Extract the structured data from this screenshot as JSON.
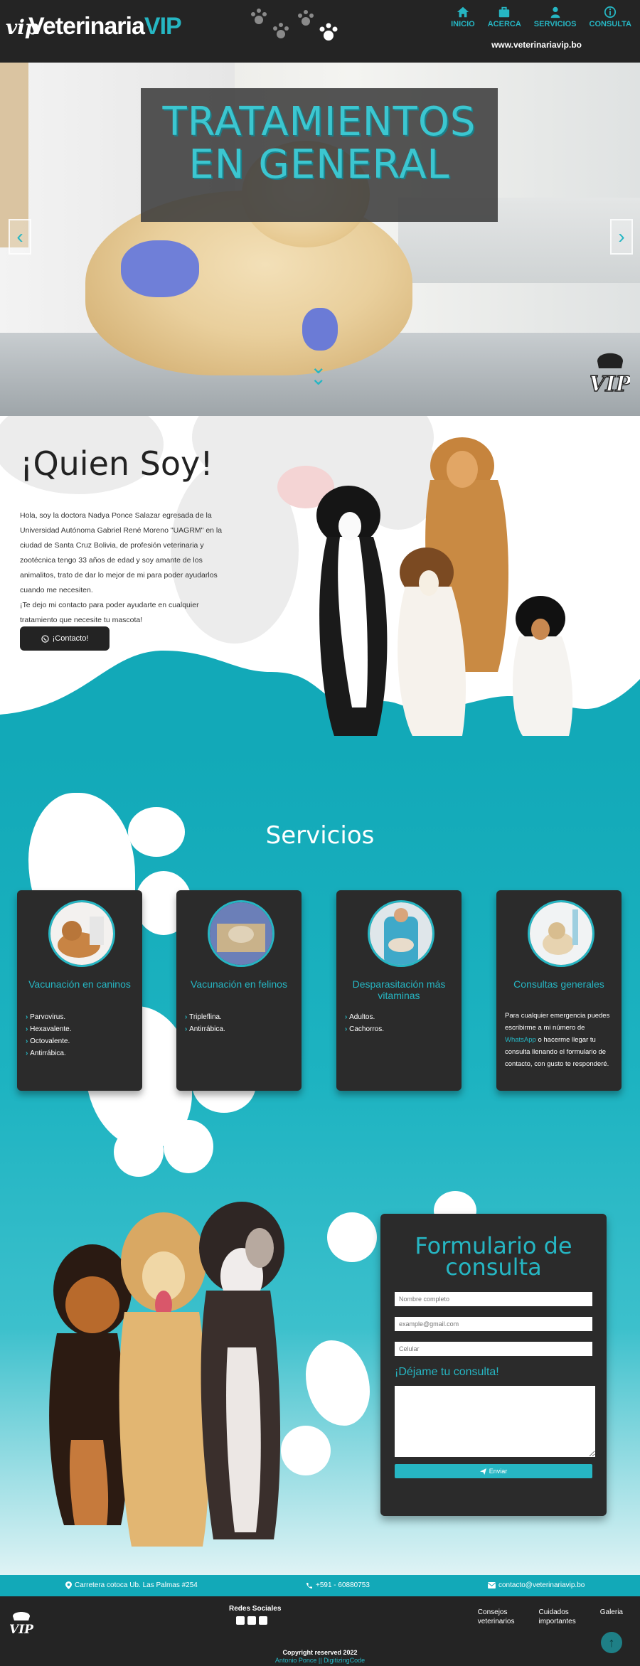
{
  "header": {
    "logo_prefix": "vip",
    "logo_name": "Veterinaria",
    "logo_accent": "VIP",
    "nav": [
      {
        "label": "INICIO",
        "icon": "home-icon"
      },
      {
        "label": "ACERCA",
        "icon": "briefcase-icon"
      },
      {
        "label": "SERVICIOS",
        "icon": "users-icon"
      },
      {
        "label": "CONSULTA",
        "icon": "info-icon"
      }
    ],
    "site_url": "www.veterinariavip.bo"
  },
  "hero": {
    "title": "TRATAMIENTOS EN GENERAL",
    "prev": "‹",
    "next": "›"
  },
  "about": {
    "title": "¡Quien Soy!",
    "paragraph1": "Hola, soy la doctora Nadya Ponce Salazar egresada de la Universidad Autónoma Gabriel René Moreno \"UAGRM\" en la ciudad de Santa Cruz Bolivia, de profesión veterinaria y zootécnica tengo 33 años de edad y soy amante de los animalitos, trato de dar lo mejor de mi para poder ayudarlos cuando me necesiten.",
    "paragraph2": "¡Te dejo mi contacto para poder ayudarte en cualquier tratamiento que necesite tu mascota!",
    "button": "¡Contacto!"
  },
  "services": {
    "title": "Servicios",
    "cards": [
      {
        "title": "Vacunación en caninos",
        "items": [
          "Parvovirus.",
          "Hexavalente.",
          "Octovalente.",
          "Antirrábica."
        ]
      },
      {
        "title": "Vacunación en felinos",
        "items": [
          "Tripleflina.",
          "Antirrábica."
        ]
      },
      {
        "title": "Desparasitación más vitaminas",
        "items": [
          "Adultos.",
          "Cachorros."
        ]
      },
      {
        "title": "Consultas generales",
        "text_before": "Para cualquier emergencia puedes escribirme a mi número de",
        "text_link": "WhatsApp",
        "text_after": "o hacerme llegar tu consulta llenando el formulario de contacto, con gusto te responderé."
      }
    ]
  },
  "form": {
    "title": "Formulario de consulta",
    "name_placeholder": "Nombre completo",
    "email_placeholder": "example@gmail.com",
    "phone_placeholder": "Celular",
    "message_label": "¡Déjame tu consulta!",
    "send": "Enviar"
  },
  "contact_bar": {
    "address": "Carretera cotoca Ub. Las Palmas #254",
    "phone": "+591 - 60880753",
    "email": "contacto@veterinariavip.bo"
  },
  "footer": {
    "social_title": "Redes Sociales",
    "links": [
      {
        "line1": "Consejos",
        "line2": "veterinarios"
      },
      {
        "line1": "Cuidados",
        "line2": "importantes"
      },
      {
        "line1": "Galeria",
        "line2": ""
      }
    ],
    "copyright": "Copyright reserved 2022",
    "author": "Antonio Ponce || DigitizingCode"
  },
  "colors": {
    "accent": "#26b6c3",
    "dark": "#242424",
    "teal": "#12a9b8"
  }
}
